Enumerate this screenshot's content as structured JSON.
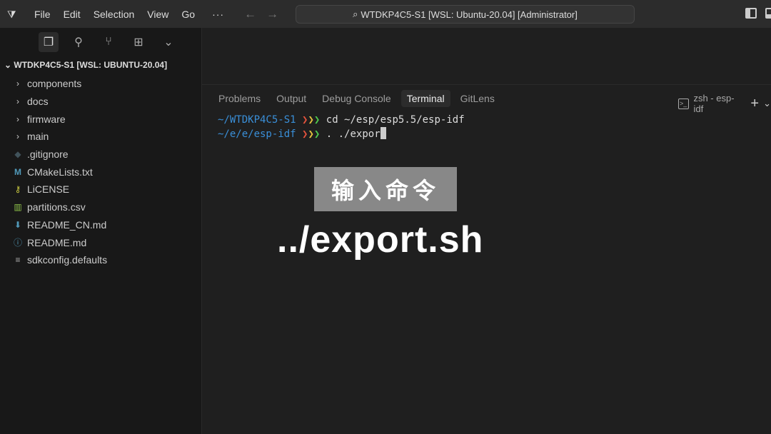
{
  "titlebar": {
    "menus": [
      "File",
      "Edit",
      "Selection",
      "View",
      "Go"
    ],
    "more": "···",
    "search": "WTDKP4C5-S1 [WSL: Ubuntu-20.04] [Administrator]"
  },
  "sidebar": {
    "root": "WTDKP4C5-S1 [WSL: UBUNTU-20.04]",
    "items": [
      {
        "label": "components",
        "icon": "chevron-right"
      },
      {
        "label": "docs",
        "icon": "chevron-right"
      },
      {
        "label": "firmware",
        "icon": "chevron-right"
      },
      {
        "label": "main",
        "icon": "chevron-right"
      },
      {
        "label": ".gitignore",
        "icon": "git-icon"
      },
      {
        "label": "CMakeLists.txt",
        "icon": "cmake-icon"
      },
      {
        "label": "LiCENSE",
        "icon": "license-icon"
      },
      {
        "label": "partitions.csv",
        "icon": "csv-icon"
      },
      {
        "label": "README_CN.md",
        "icon": "markdown-download-icon"
      },
      {
        "label": "README.md",
        "icon": "info-icon"
      },
      {
        "label": "sdkconfig.defaults",
        "icon": "lines-icon"
      }
    ]
  },
  "panel": {
    "tabs": [
      "Problems",
      "Output",
      "Debug Console",
      "Terminal",
      "GitLens"
    ],
    "active": "Terminal",
    "terminal_name": "zsh - esp-idf"
  },
  "terminal": {
    "lines": [
      {
        "path": "~/WTDKP4C5-S1",
        "cmd": "cd ~/esp/esp5.5/esp-idf"
      },
      {
        "path": "~/e/e/esp-idf",
        "cmd": ". ./expor"
      }
    ]
  },
  "overlay": {
    "caption": "输入命令",
    "command": "../export.sh"
  }
}
